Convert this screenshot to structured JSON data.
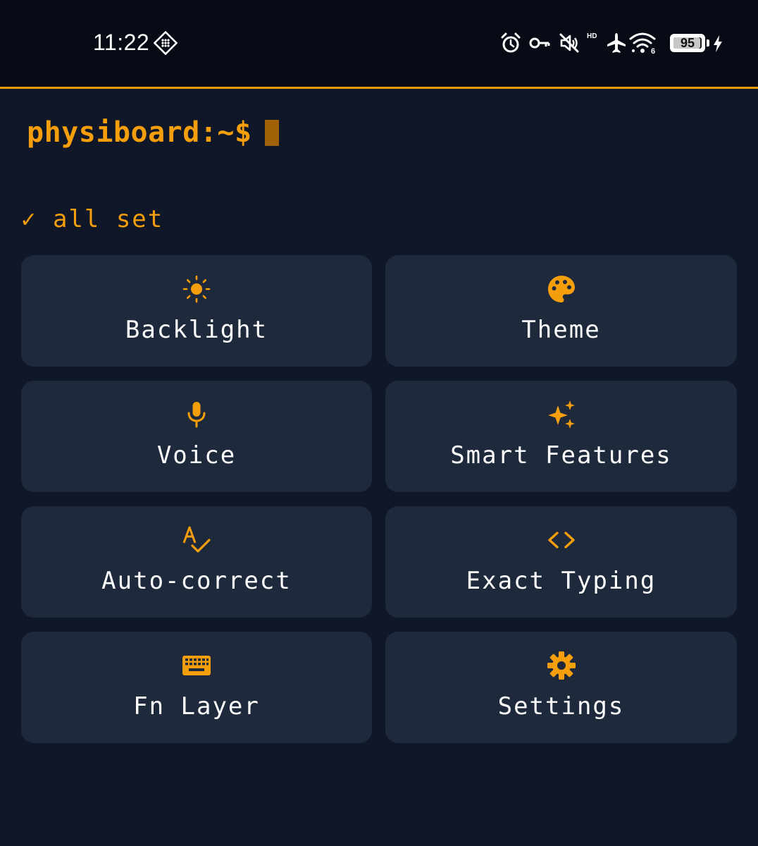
{
  "status_bar": {
    "time": "11:22",
    "battery_percent": "95",
    "hd_label": "HD",
    "wifi_generation": "6",
    "icons": [
      "alarm-icon",
      "vpn-key-icon",
      "muted-icon",
      "airplane-icon",
      "wifi-icon",
      "battery-icon",
      "charging-icon"
    ]
  },
  "terminal": {
    "prompt": "physiboard:~$",
    "status_message": "✓ all set"
  },
  "colors": {
    "accent": "#f59e0b",
    "background": "#0f1729",
    "tile": "#1e293b",
    "text": "#ffffff"
  },
  "tiles": [
    {
      "label": "Backlight",
      "icon": "sun-icon"
    },
    {
      "label": "Theme",
      "icon": "palette-icon"
    },
    {
      "label": "Voice",
      "icon": "microphone-icon"
    },
    {
      "label": "Smart Features",
      "icon": "sparkles-icon"
    },
    {
      "label": "Auto-correct",
      "icon": "spellcheck-icon"
    },
    {
      "label": "Exact Typing",
      "icon": "code-brackets-icon"
    },
    {
      "label": "Fn Layer",
      "icon": "keyboard-icon"
    },
    {
      "label": "Settings",
      "icon": "gear-icon"
    }
  ]
}
